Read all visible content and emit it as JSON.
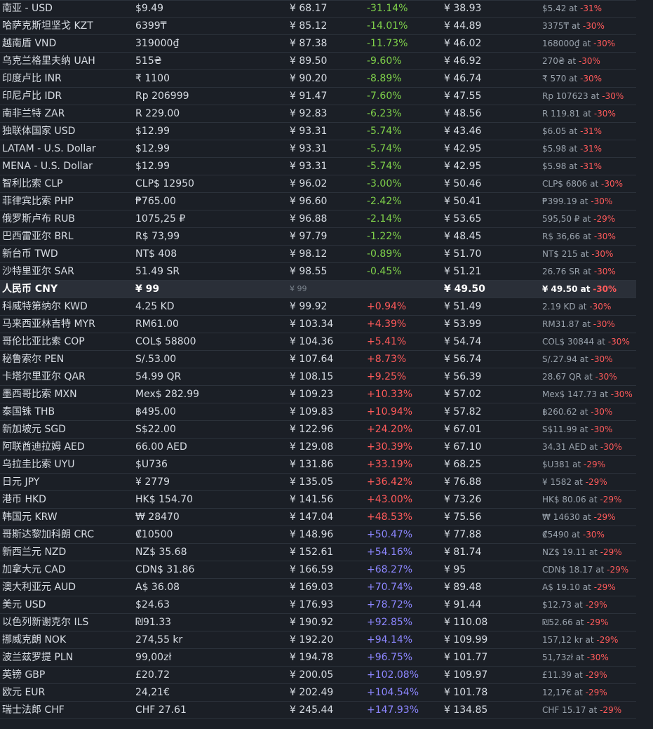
{
  "rows": [
    {
      "name": "南亚 - USD",
      "local": "$9.49",
      "cny": "¥ 68.17",
      "diff": "-31.14%",
      "diff_class": "neg",
      "sale": "¥ 38.93",
      "note_price": "$5.42 at",
      "note_pct": "-31%"
    },
    {
      "name": "哈萨克斯坦坚戈 KZT",
      "local": "6399₸",
      "cny": "¥ 85.12",
      "diff": "-14.01%",
      "diff_class": "neg",
      "sale": "¥ 44.89",
      "note_price": "3375₸ at",
      "note_pct": "-30%"
    },
    {
      "name": "越南盾 VND",
      "local": "319000₫",
      "cny": "¥ 87.38",
      "diff": "-11.73%",
      "diff_class": "neg",
      "sale": "¥ 46.02",
      "note_price": "168000₫ at",
      "note_pct": "-30%"
    },
    {
      "name": "乌克兰格里夫纳 UAH",
      "local": "515₴",
      "cny": "¥ 89.50",
      "diff": "-9.60%",
      "diff_class": "neg",
      "sale": "¥ 46.92",
      "note_price": "270₴ at",
      "note_pct": "-30%"
    },
    {
      "name": "印度卢比 INR",
      "local": "₹ 1100",
      "cny": "¥ 90.20",
      "diff": "-8.89%",
      "diff_class": "neg",
      "sale": "¥ 46.74",
      "note_price": "₹ 570 at",
      "note_pct": "-30%"
    },
    {
      "name": "印尼卢比 IDR",
      "local": "Rp 206999",
      "cny": "¥ 91.47",
      "diff": "-7.60%",
      "diff_class": "neg",
      "sale": "¥ 47.55",
      "note_price": "Rp 107623 at",
      "note_pct": "-30%"
    },
    {
      "name": "南非兰特 ZAR",
      "local": "R 229.00",
      "cny": "¥ 92.83",
      "diff": "-6.23%",
      "diff_class": "neg",
      "sale": "¥ 48.56",
      "note_price": "R 119.81 at",
      "note_pct": "-30%"
    },
    {
      "name": "独联体国家 USD",
      "local": "$12.99",
      "cny": "¥ 93.31",
      "diff": "-5.74%",
      "diff_class": "neg",
      "sale": "¥ 43.46",
      "note_price": "$6.05 at",
      "note_pct": "-31%"
    },
    {
      "name": "LATAM - U.S. Dollar",
      "local": "$12.99",
      "cny": "¥ 93.31",
      "diff": "-5.74%",
      "diff_class": "neg",
      "sale": "¥ 42.95",
      "note_price": "$5.98 at",
      "note_pct": "-31%"
    },
    {
      "name": "MENA - U.S. Dollar",
      "local": "$12.99",
      "cny": "¥ 93.31",
      "diff": "-5.74%",
      "diff_class": "neg",
      "sale": "¥ 42.95",
      "note_price": "$5.98 at",
      "note_pct": "-31%"
    },
    {
      "name": "智利比索 CLP",
      "local": "CLP$ 12950",
      "cny": "¥ 96.02",
      "diff": "-3.00%",
      "diff_class": "neg",
      "sale": "¥ 50.46",
      "note_price": "CLP$ 6806 at",
      "note_pct": "-30%"
    },
    {
      "name": "菲律宾比索 PHP",
      "local": "₱765.00",
      "cny": "¥ 96.60",
      "diff": "-2.42%",
      "diff_class": "neg",
      "sale": "¥ 50.41",
      "note_price": "₱399.19 at",
      "note_pct": "-30%"
    },
    {
      "name": "俄罗斯卢布 RUB",
      "local": "1075,25 ₽",
      "cny": "¥ 96.88",
      "diff": "-2.14%",
      "diff_class": "neg",
      "sale": "¥ 53.65",
      "note_price": "595,50 ₽ at",
      "note_pct": "-29%"
    },
    {
      "name": "巴西雷亚尔 BRL",
      "local": "R$ 73,99",
      "cny": "¥ 97.79",
      "diff": "-1.22%",
      "diff_class": "neg",
      "sale": "¥ 48.45",
      "note_price": "R$ 36,66 at",
      "note_pct": "-30%"
    },
    {
      "name": "新台币 TWD",
      "local": "NT$ 408",
      "cny": "¥ 98.12",
      "diff": "-0.89%",
      "diff_class": "neg",
      "sale": "¥ 51.70",
      "note_price": "NT$ 215 at",
      "note_pct": "-30%"
    },
    {
      "name": "沙特里亚尔 SAR",
      "local": "51.49 SR",
      "cny": "¥ 98.55",
      "diff": "-0.45%",
      "diff_class": "neg",
      "sale": "¥ 51.21",
      "note_price": "26.76 SR at",
      "note_pct": "-30%"
    },
    {
      "name": "人民币 CNY",
      "local": "¥ 99",
      "cny": "¥ 99",
      "diff": "",
      "diff_class": "",
      "sale": "¥ 49.50",
      "note_price": "¥ 49.50 at",
      "note_pct": "-30%",
      "highlight": true
    },
    {
      "name": "科威特第纳尔 KWD",
      "local": "4.25 KD",
      "cny": "¥ 99.92",
      "diff": "+0.94%",
      "diff_class": "pos-red",
      "sale": "¥ 51.49",
      "note_price": "2.19 KD at",
      "note_pct": "-30%"
    },
    {
      "name": "马来西亚林吉特 MYR",
      "local": "RM61.00",
      "cny": "¥ 103.34",
      "diff": "+4.39%",
      "diff_class": "pos-red",
      "sale": "¥ 53.99",
      "note_price": "RM31.87 at",
      "note_pct": "-30%"
    },
    {
      "name": "哥伦比亚比索 COP",
      "local": "COL$ 58800",
      "cny": "¥ 104.36",
      "diff": "+5.41%",
      "diff_class": "pos-red",
      "sale": "¥ 54.74",
      "note_price": "COL$ 30844 at",
      "note_pct": "-30%"
    },
    {
      "name": "秘鲁索尔 PEN",
      "local": "S/.53.00",
      "cny": "¥ 107.64",
      "diff": "+8.73%",
      "diff_class": "pos-red",
      "sale": "¥ 56.74",
      "note_price": "S/.27.94 at",
      "note_pct": "-30%"
    },
    {
      "name": "卡塔尔里亚尔 QAR",
      "local": "54.99 QR",
      "cny": "¥ 108.15",
      "diff": "+9.25%",
      "diff_class": "pos-red",
      "sale": "¥ 56.39",
      "note_price": "28.67 QR at",
      "note_pct": "-30%"
    },
    {
      "name": "墨西哥比索 MXN",
      "local": "Mex$ 282.99",
      "cny": "¥ 109.23",
      "diff": "+10.33%",
      "diff_class": "pos-red",
      "sale": "¥ 57.02",
      "note_price": "Mex$ 147.73 at",
      "note_pct": "-30%"
    },
    {
      "name": "泰国铢 THB",
      "local": "฿495.00",
      "cny": "¥ 109.83",
      "diff": "+10.94%",
      "diff_class": "pos-red",
      "sale": "¥ 57.82",
      "note_price": "฿260.62 at",
      "note_pct": "-30%"
    },
    {
      "name": "新加坡元 SGD",
      "local": "S$22.00",
      "cny": "¥ 122.96",
      "diff": "+24.20%",
      "diff_class": "pos-red",
      "sale": "¥ 67.01",
      "note_price": "S$11.99 at",
      "note_pct": "-30%"
    },
    {
      "name": "阿联酋迪拉姆 AED",
      "local": "66.00 AED",
      "cny": "¥ 129.08",
      "diff": "+30.39%",
      "diff_class": "pos-red",
      "sale": "¥ 67.10",
      "note_price": "34.31 AED at",
      "note_pct": "-30%"
    },
    {
      "name": "乌拉圭比索 UYU",
      "local": "$U736",
      "cny": "¥ 131.86",
      "diff": "+33.19%",
      "diff_class": "pos-red",
      "sale": "¥ 68.25",
      "note_price": "$U381 at",
      "note_pct": "-29%"
    },
    {
      "name": "日元 JPY",
      "local": "¥ 2779",
      "cny": "¥ 135.05",
      "diff": "+36.42%",
      "diff_class": "pos-red",
      "sale": "¥ 76.88",
      "note_price": "¥ 1582 at",
      "note_pct": "-29%"
    },
    {
      "name": "港币 HKD",
      "local": "HK$ 154.70",
      "cny": "¥ 141.56",
      "diff": "+43.00%",
      "diff_class": "pos-red",
      "sale": "¥ 73.26",
      "note_price": "HK$ 80.06 at",
      "note_pct": "-29%"
    },
    {
      "name": "韩国元 KRW",
      "local": "₩ 28470",
      "cny": "¥ 147.04",
      "diff": "+48.53%",
      "diff_class": "pos-red",
      "sale": "¥ 75.56",
      "note_price": "₩ 14630 at",
      "note_pct": "-29%"
    },
    {
      "name": "哥斯达黎加科朗 CRC",
      "local": "₡10500",
      "cny": "¥ 148.96",
      "diff": "+50.47%",
      "diff_class": "pos-blue",
      "sale": "¥ 77.88",
      "note_price": "₡5490 at",
      "note_pct": "-30%"
    },
    {
      "name": "新西兰元 NZD",
      "local": "NZ$ 35.68",
      "cny": "¥ 152.61",
      "diff": "+54.16%",
      "diff_class": "pos-blue",
      "sale": "¥ 81.74",
      "note_price": "NZ$ 19.11 at",
      "note_pct": "-29%"
    },
    {
      "name": "加拿大元 CAD",
      "local": "CDN$ 31.86",
      "cny": "¥ 166.59",
      "diff": "+68.27%",
      "diff_class": "pos-blue",
      "sale": "¥ 95",
      "note_price": "CDN$ 18.17 at",
      "note_pct": "-29%"
    },
    {
      "name": "澳大利亚元 AUD",
      "local": "A$ 36.08",
      "cny": "¥ 169.03",
      "diff": "+70.74%",
      "diff_class": "pos-blue",
      "sale": "¥ 89.48",
      "note_price": "A$ 19.10 at",
      "note_pct": "-29%"
    },
    {
      "name": "美元 USD",
      "local": "$24.63",
      "cny": "¥ 176.93",
      "diff": "+78.72%",
      "diff_class": "pos-blue",
      "sale": "¥ 91.44",
      "note_price": "$12.73 at",
      "note_pct": "-29%"
    },
    {
      "name": "以色列新谢克尔 ILS",
      "local": "₪91.33",
      "cny": "¥ 190.92",
      "diff": "+92.85%",
      "diff_class": "pos-blue",
      "sale": "¥ 110.08",
      "note_price": "₪52.66 at",
      "note_pct": "-29%"
    },
    {
      "name": "挪威克朗 NOK",
      "local": "274,55 kr",
      "cny": "¥ 192.20",
      "diff": "+94.14%",
      "diff_class": "pos-blue",
      "sale": "¥ 109.99",
      "note_price": "157,12 kr at",
      "note_pct": "-29%"
    },
    {
      "name": "波兰兹罗提 PLN",
      "local": "99,00zł",
      "cny": "¥ 194.78",
      "diff": "+96.75%",
      "diff_class": "pos-blue",
      "sale": "¥ 101.77",
      "note_price": "51,73zł at",
      "note_pct": "-30%"
    },
    {
      "name": "英镑 GBP",
      "local": "£20.72",
      "cny": "¥ 200.05",
      "diff": "+102.08%",
      "diff_class": "pos-blue",
      "sale": "¥ 109.97",
      "note_price": "£11.39 at",
      "note_pct": "-29%"
    },
    {
      "name": "欧元 EUR",
      "local": "24,21€",
      "cny": "¥ 202.49",
      "diff": "+104.54%",
      "diff_class": "pos-blue",
      "sale": "¥ 101.78",
      "note_price": "12,17€ at",
      "note_pct": "-29%"
    },
    {
      "name": "瑞士法郎 CHF",
      "local": "CHF 27.61",
      "cny": "¥ 245.44",
      "diff": "+147.93%",
      "diff_class": "pos-blue",
      "sale": "¥ 134.85",
      "note_price": "CHF 15.17 at",
      "note_pct": "-29%"
    }
  ],
  "colors": {
    "background": "#1b1f26",
    "row_border": "#2c323b",
    "highlight_row": "#2a2f38",
    "cheaper_green": "#7fd14a",
    "pricier_red": "#ff5a5a",
    "pricier_blue": "#8c86ff",
    "sale_pct_red": "#ff5a5a"
  }
}
